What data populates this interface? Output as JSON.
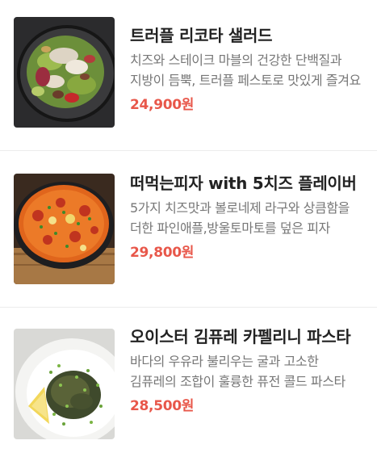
{
  "menu": {
    "items": [
      {
        "name": "트러플 리코타 샐러드",
        "description": "치즈와 스테이크 마블의 건강한 단백질과 지방이 듬뿍, 트러플 페스토로 맛있게 즐겨요",
        "price": "24,900원",
        "image_icon": "salad-photo"
      },
      {
        "name": "떠먹는피자 with 5치즈 플레이버",
        "description": "5가지 치즈맛과 볼로네제 라구와 상큼함을 더한 파인애플,방울토마토를 덮은 피자",
        "price": "29,800원",
        "image_icon": "pizza-photo"
      },
      {
        "name": "오이스터 김퓨레 카펠리니 파스타",
        "description": "바다의 우유라 불리우는 굴과 고소한 김퓨레의 조합이 훌륭한 퓨전 콜드 파스타",
        "price": "28,500원",
        "image_icon": "pasta-photo"
      }
    ],
    "colors": {
      "price": "#e8574a",
      "title": "#222222",
      "description": "#777777"
    }
  }
}
